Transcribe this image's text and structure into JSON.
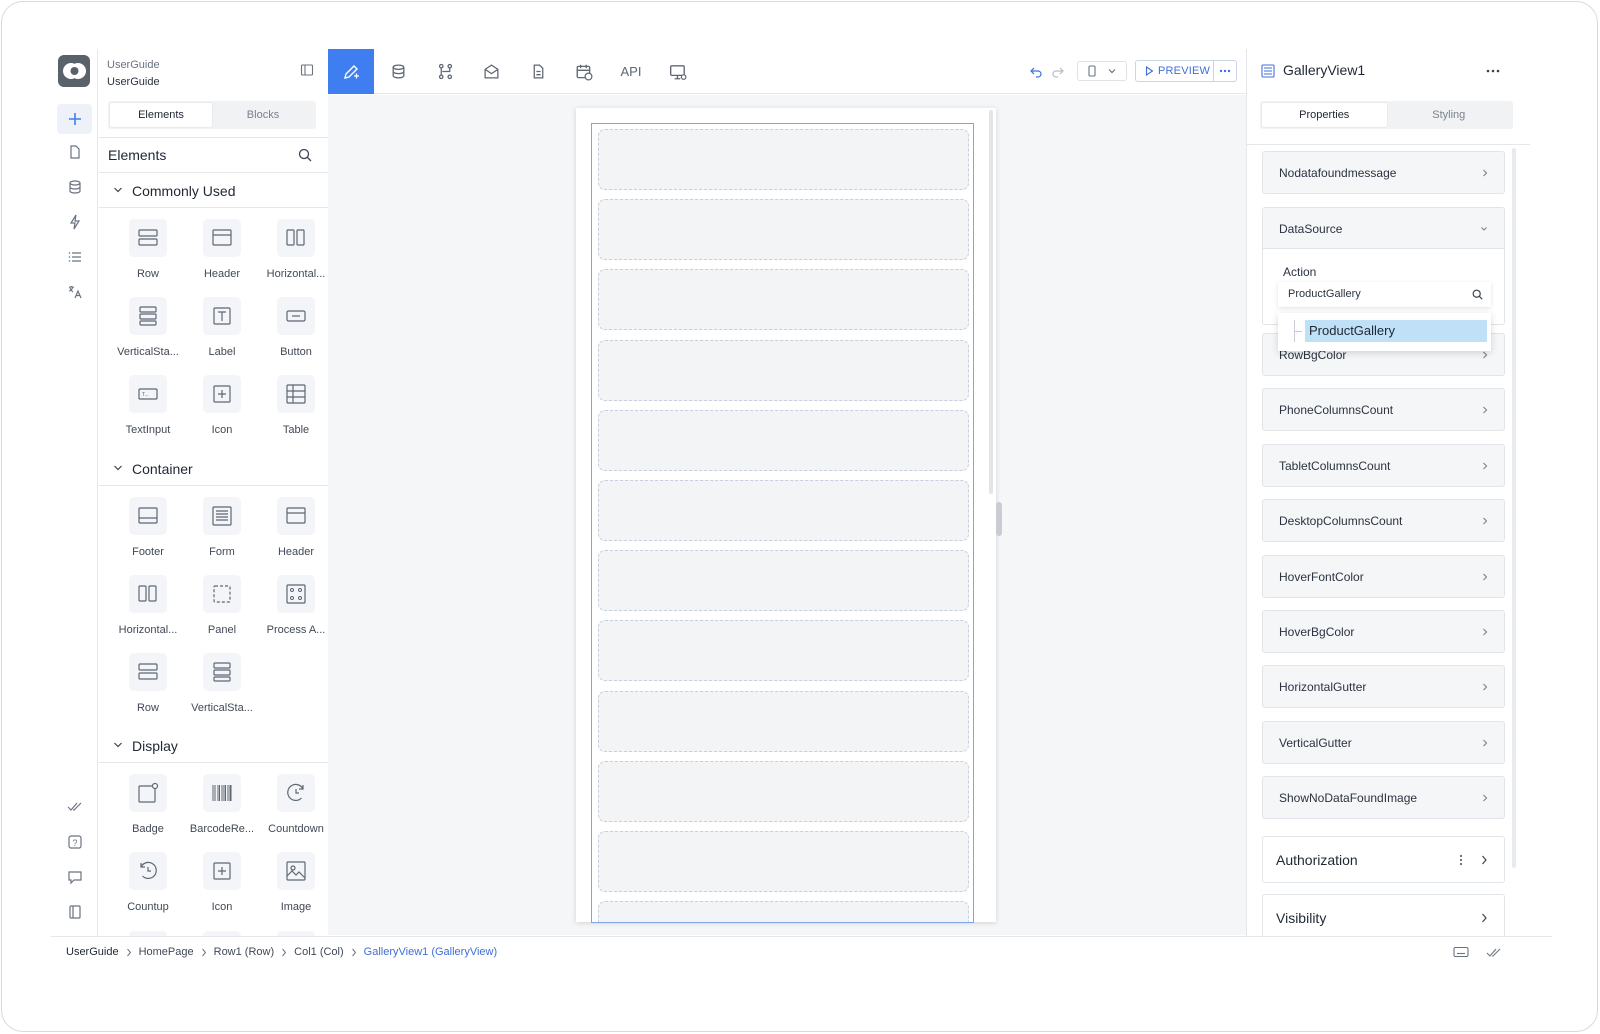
{
  "project": {
    "title": "UserGuide",
    "subtitle": "UserGuide"
  },
  "left_tabs": {
    "elements": "Elements",
    "blocks": "Blocks"
  },
  "elements_header": "Elements",
  "sections": [
    {
      "title": "Commonly Used",
      "items": [
        "Row",
        "Header",
        "Horizontal...",
        "VerticalSta...",
        "Label",
        "Button",
        "TextInput",
        "Icon",
        "Table"
      ]
    },
    {
      "title": "Container",
      "items": [
        "Footer",
        "Form",
        "Header",
        "Horizontal...",
        "Panel",
        "Process A...",
        "Row",
        "VerticalSta..."
      ]
    },
    {
      "title": "Display",
      "items": [
        "Badge",
        "BarcodeRe...",
        "Countdown",
        "Countup",
        "Icon",
        "Image"
      ]
    }
  ],
  "toolbar": {
    "api_label": "API",
    "preview_label": "PREVIEW"
  },
  "gallery": {
    "item_count": 12
  },
  "right_panel": {
    "title": "GalleryView1",
    "tabs": {
      "properties": "Properties",
      "styling": "Styling"
    },
    "nodata": "Nodatafoundmessage",
    "datasource": "DataSource",
    "action_label": "Action",
    "action_value": "ProductGallery",
    "dropdown_option": "ProductGallery",
    "properties": [
      "RowBgColor",
      "PhoneColumnsCount",
      "TabletColumnsCount",
      "DesktopColumnsCount",
      "HoverFontColor",
      "HoverBgColor",
      "HorizontalGutter",
      "VerticalGutter",
      "ShowNoDataFoundImage"
    ],
    "authorization": "Authorization",
    "visibility": "Visibility"
  },
  "breadcrumb": [
    "UserGuide",
    "HomePage",
    "Row1 (Row)",
    "Col1 (Col)",
    "GalleryView1 (GalleryView)"
  ],
  "colors": {
    "accent": "#3f7ef0",
    "selected": "#bfe0f7",
    "border": "#e5e7ea"
  }
}
